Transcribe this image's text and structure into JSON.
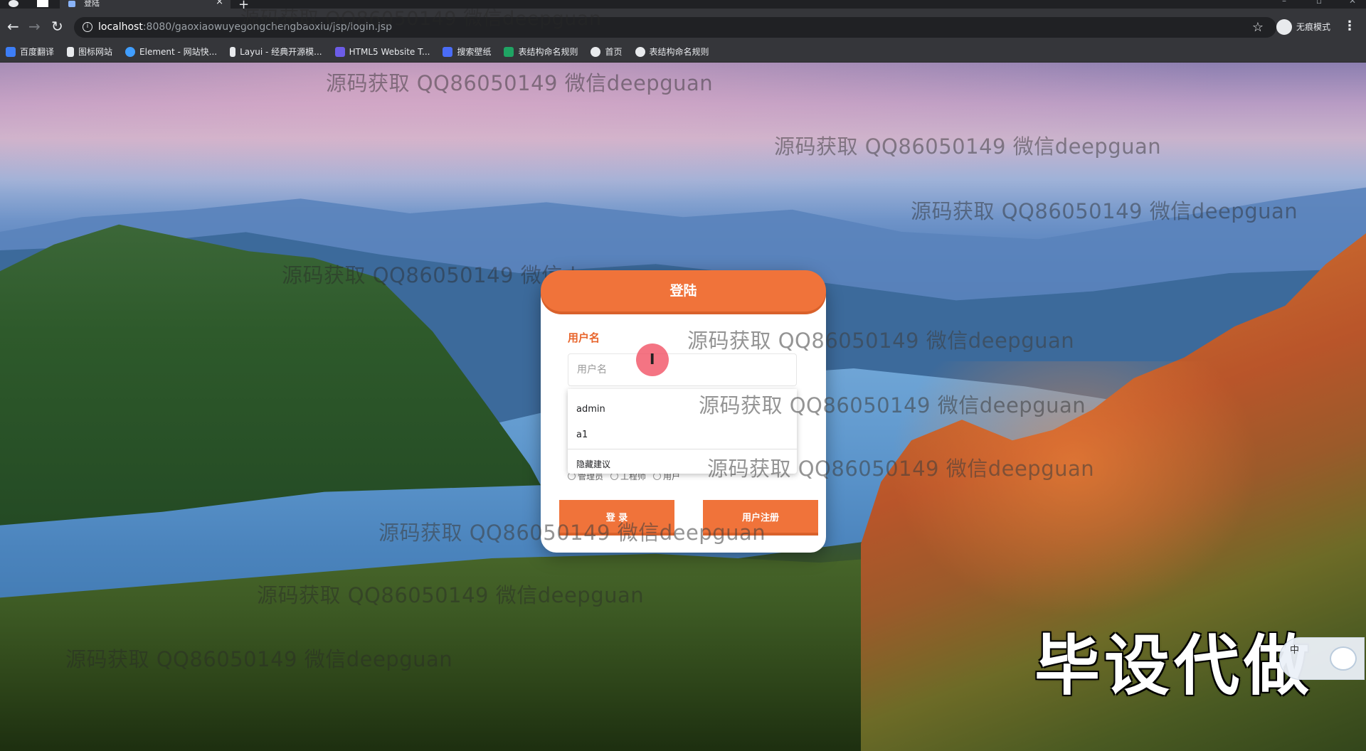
{
  "browser": {
    "tab_title": "登陆",
    "tab_close": "×",
    "new_tab": "+",
    "url_host": "localhost",
    "url_path": ":8080/gaoxiaowuyegongchengbaoxiu/jsp/login.jsp",
    "incognito_label": "无痕模式",
    "bookmarks": [
      {
        "label": "百度翻译",
        "icon": "baidu-translate-icon",
        "color": "#3d7ef7"
      },
      {
        "label": "图标网站",
        "icon": "flag-icon",
        "color": "#e8eaed"
      },
      {
        "label": "Element - 网站快...",
        "icon": "element-icon",
        "color": "#409eff"
      },
      {
        "label": "Layui - 经典开源模...",
        "icon": "layui-icon",
        "color": "#e8eaed"
      },
      {
        "label": "HTML5 Website T...",
        "icon": "html5-icon",
        "color": "#6c5ce7"
      },
      {
        "label": "搜索壁纸",
        "icon": "wallpaper-icon",
        "color": "#4a6cf7"
      },
      {
        "label": "表结构命名规则",
        "icon": "sheet-icon",
        "color": "#1fa463"
      },
      {
        "label": "首页",
        "icon": "globe-icon",
        "color": "#e8eaed"
      },
      {
        "label": "表结构命名规则",
        "icon": "globe-icon",
        "color": "#e8eaed"
      }
    ]
  },
  "login": {
    "title": "登陆",
    "username_label": "用户名",
    "username_placeholder": "用户名",
    "suggestions": [
      "admin",
      "a1"
    ],
    "hide_suggestions": "隐藏建议",
    "roles": [
      "管理员",
      "工程师",
      "用户"
    ],
    "login_button": "登 录",
    "register_button": "用户注册"
  },
  "overlay": {
    "watermark_text": "源码获取 QQ86050149 微信deepguan",
    "stamp_text": "毕设代做",
    "ime_label": "中"
  },
  "colors": {
    "accent": "#f0733a",
    "label": "#e8652c"
  }
}
